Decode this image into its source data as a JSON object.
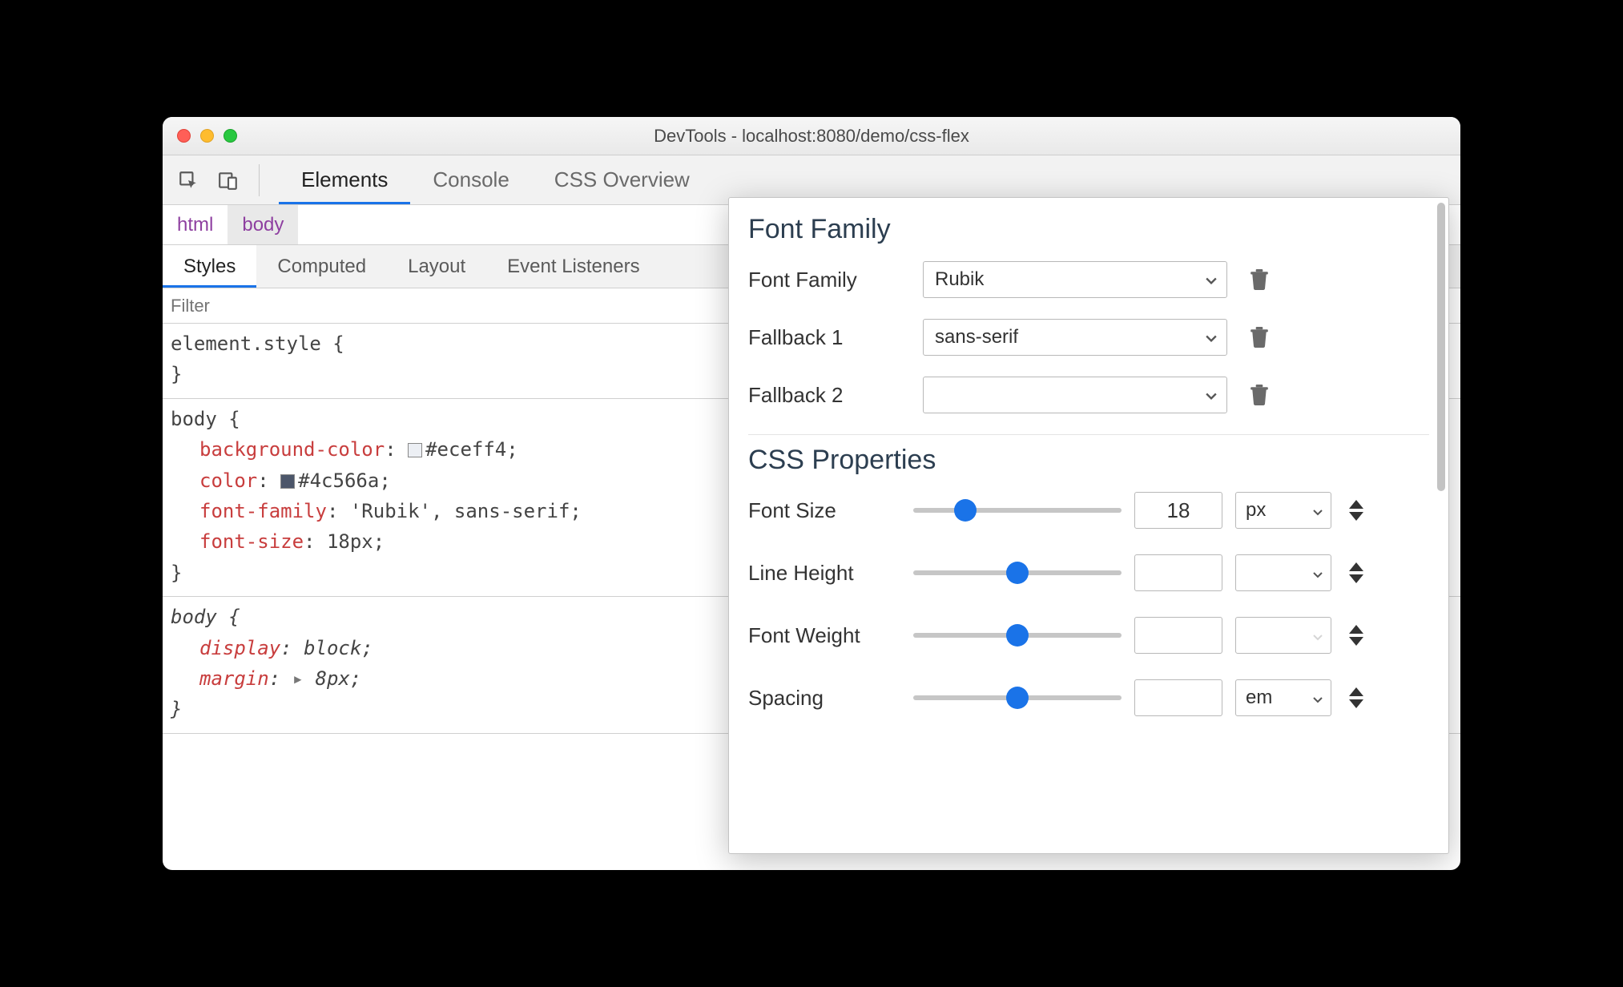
{
  "window": {
    "title": "DevTools - localhost:8080/demo/css-flex"
  },
  "tabs": {
    "items": [
      "Elements",
      "Console",
      "CSS Overview"
    ],
    "activeIndex": 0
  },
  "breadcrumb": {
    "items": [
      "html",
      "body"
    ],
    "selectedIndex": 1
  },
  "subtabs": {
    "items": [
      "Styles",
      "Computed",
      "Layout",
      "Event Listeners"
    ],
    "activeIndex": 0
  },
  "filter": {
    "placeholder": "Filter",
    "value": ""
  },
  "rules": [
    {
      "selector": "element.style {",
      "close": "}",
      "props": []
    },
    {
      "selector": "body {",
      "close": "}",
      "props": [
        {
          "name": "background-color",
          "value": "#eceff4",
          "swatch": "#eceff4"
        },
        {
          "name": "color",
          "value": "#4c566a",
          "swatch": "#4c566a"
        },
        {
          "name": "font-family",
          "value": "'Rubik', sans-serif"
        },
        {
          "name": "font-size",
          "value": "18px"
        }
      ]
    },
    {
      "selector": "body {",
      "italic": true,
      "close": "}",
      "props": [
        {
          "name": "display",
          "value": "block",
          "italic": true
        },
        {
          "name": "margin",
          "value": "8px",
          "italic": true,
          "expand": true
        }
      ]
    }
  ],
  "font_editor": {
    "font_family_title": "Font Family",
    "rows": [
      {
        "label": "Font Family",
        "value": "Rubik"
      },
      {
        "label": "Fallback 1",
        "value": "sans-serif"
      },
      {
        "label": "Fallback 2",
        "value": ""
      }
    ],
    "css_props_title": "CSS Properties",
    "props": [
      {
        "label": "Font Size",
        "value": "18",
        "unit": "px",
        "thumb": 25
      },
      {
        "label": "Line Height",
        "value": "",
        "unit": "",
        "thumb": 50
      },
      {
        "label": "Font Weight",
        "value": "",
        "unit": "",
        "thumb": 50,
        "unitDisabled": true
      },
      {
        "label": "Spacing",
        "value": "",
        "unit": "em",
        "thumb": 50
      }
    ]
  }
}
